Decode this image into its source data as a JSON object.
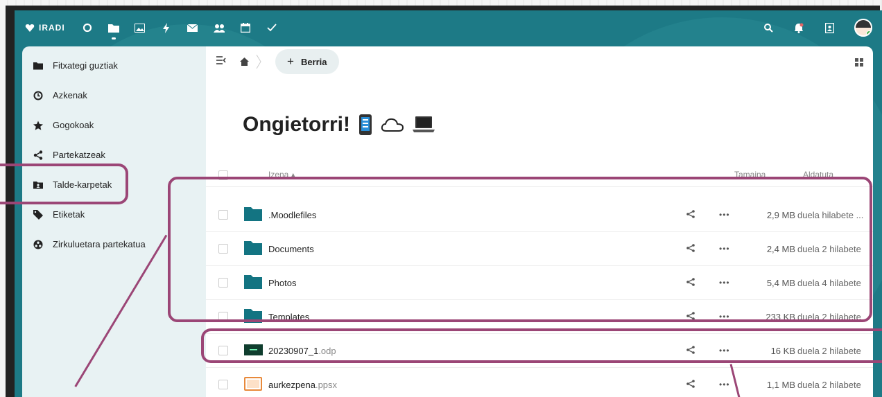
{
  "topbar": {
    "brand": "IRADI",
    "app_icons": [
      "dashboard-icon",
      "files-icon",
      "photos-icon",
      "activity-icon",
      "mail-icon",
      "contacts-icon",
      "calendar-icon",
      "tasks-icon"
    ],
    "right_icons": [
      "search-icon",
      "notifications-icon",
      "contacts-menu-icon",
      "user-avatar"
    ]
  },
  "sidebar": {
    "items": [
      {
        "label": "Fitxategi guztiak",
        "icon": "folder-icon"
      },
      {
        "label": "Azkenak",
        "icon": "clock-icon"
      },
      {
        "label": "Gogokoak",
        "icon": "star-icon"
      },
      {
        "label": "Partekatzeak",
        "icon": "share-icon"
      },
      {
        "label": "Talde-karpetak",
        "icon": "group-folder-icon"
      },
      {
        "label": "Etiketak",
        "icon": "tag-icon"
      },
      {
        "label": "Zirkuluetara partekatua",
        "icon": "circles-icon"
      }
    ]
  },
  "toolbar": {
    "new_label": "Berria"
  },
  "welcome": {
    "title": "Ongietorri!"
  },
  "table": {
    "col_name": "Izena",
    "col_size": "Tamaina",
    "col_modified": "Aldatuta",
    "rows": [
      {
        "name": ".Moodlefiles",
        "ext": "",
        "type": "folder",
        "size": "2,9 MB",
        "modified": "duela hilabete ..."
      },
      {
        "name": "Documents",
        "ext": "",
        "type": "folder",
        "size": "2,4 MB",
        "modified": "duela 2 hilabete"
      },
      {
        "name": "Photos",
        "ext": "",
        "type": "folder",
        "size": "5,4 MB",
        "modified": "duela 4 hilabete"
      },
      {
        "name": "Templates",
        "ext": "",
        "type": "folder",
        "size": "233 KB",
        "modified": "duela 2 hilabete"
      },
      {
        "name": "20230907_1",
        "ext": ".odp",
        "type": "odp",
        "size": "16 KB",
        "modified": "duela 2 hilabete"
      },
      {
        "name": "aurkezpena",
        "ext": ".ppsx",
        "type": "ppsx",
        "size": "1,1 MB",
        "modified": "duela 2 hilabete"
      }
    ]
  },
  "colors": {
    "accent": "#1d7a86",
    "highlight": "#9b4676",
    "folder": "#137482"
  }
}
